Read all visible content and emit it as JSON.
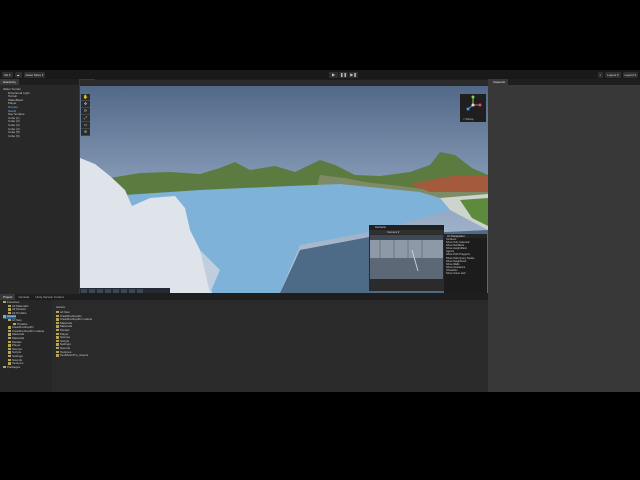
{
  "topbar": {
    "account": "SH ▾",
    "cloud": "☁",
    "asset_store": "Asset Store ▾",
    "search": "⌕",
    "layers": "Layers ▾",
    "layout": "Layout ▾",
    "play_icons": [
      "▶",
      "❚❚",
      "▶❚"
    ]
  },
  "hierarchy": {
    "tab": "Hierarchy",
    "items": [
      {
        "label": "Water Terrain",
        "depth": 0,
        "selected": false
      },
      {
        "label": "Directional Light",
        "depth": 1,
        "selected": false
      },
      {
        "label": "Terrain",
        "depth": 1,
        "selected": false
      },
      {
        "label": "WaterBasic",
        "depth": 1,
        "selected": false
      },
      {
        "label": "Player",
        "depth": 1,
        "selected": false
      },
      {
        "label": "Groups",
        "depth": 1,
        "selected": true
      },
      {
        "label": "NavAI",
        "depth": 1,
        "selected": true
      },
      {
        "label": "Nav Surface",
        "depth": 1,
        "selected": false
      },
      {
        "label": "Cube (1)",
        "depth": 1,
        "selected": false
      },
      {
        "label": "Cube (2)",
        "depth": 1,
        "selected": false
      },
      {
        "label": "Cube (3)",
        "depth": 1,
        "selected": false
      },
      {
        "label": "Cube (4)",
        "depth": 1,
        "selected": false
      },
      {
        "label": "Cube (5)",
        "depth": 1,
        "selected": false
      },
      {
        "label": "Cube (6)",
        "depth": 1,
        "selected": false
      }
    ]
  },
  "scene": {
    "tabs": [
      "Scene",
      "Game",
      "AI Navigation"
    ],
    "gizmo_label": "< Persp",
    "overlay_title": "Camera",
    "overlay_dropdown": "Camera ▾",
    "ai_panel_title": "AI Navigation",
    "ai_items": [
      "Surfaces",
      "Show Only Selected",
      "Show NavMesh",
      "Show HeightMesh",
      "Agents",
      "Show Path Polygons",
      "Show Path Query Nodes",
      "Show Neighbours",
      "Show Walls",
      "Show Avoidance",
      "Obstacles",
      "Show Carve Hull"
    ]
  },
  "project": {
    "tabs": [
      "Project",
      "Console",
      "Unity Version Control"
    ],
    "tree": [
      {
        "label": "Favorites",
        "depth": 0,
        "highlight": false
      },
      {
        "label": "All Materials",
        "depth": 1,
        "highlight": false
      },
      {
        "label": "All Models",
        "depth": 1,
        "highlight": false
      },
      {
        "label": "All Prefabs",
        "depth": 1,
        "highlight": false
      },
      {
        "label": "Assets",
        "depth": 0,
        "highlight": true
      },
      {
        "label": "AI Navi",
        "depth": 1,
        "highlight": false
      },
      {
        "label": "Prefabs",
        "depth": 2,
        "highlight": false
      },
      {
        "label": "ClearRooftop2D",
        "depth": 1,
        "highlight": false
      },
      {
        "label": "ClearRooftop3D models",
        "depth": 1,
        "highlight": false
      },
      {
        "label": "Materials",
        "depth": 1,
        "highlight": false
      },
      {
        "label": "Materials",
        "depth": 1,
        "highlight": false
      },
      {
        "label": "Models",
        "depth": 1,
        "highlight": false
      },
      {
        "label": "Player",
        "depth": 1,
        "highlight": false
      },
      {
        "label": "Scenes",
        "depth": 1,
        "highlight": false
      },
      {
        "label": "Scripts",
        "depth": 1,
        "highlight": false
      },
      {
        "label": "Settings",
        "depth": 1,
        "highlight": false
      },
      {
        "label": "Sounds",
        "depth": 1,
        "highlight": false
      },
      {
        "label": "Textures",
        "depth": 1,
        "highlight": false
      },
      {
        "label": "Packages",
        "depth": 0,
        "highlight": false
      }
    ],
    "breadcrumb": "Assets",
    "assets": [
      "AI Navi",
      "ClearRooftop2D",
      "ClearRooftop3D models",
      "Materials",
      "Materials",
      "Models",
      "Player",
      "Scenes",
      "Scripts",
      "Settings",
      "Sounds",
      "Textures",
      "TextMeshPro_Assets"
    ]
  },
  "inspector": {
    "tab": "Inspector"
  },
  "colors": {
    "accent": "#2c5d87",
    "background": "#383838"
  }
}
